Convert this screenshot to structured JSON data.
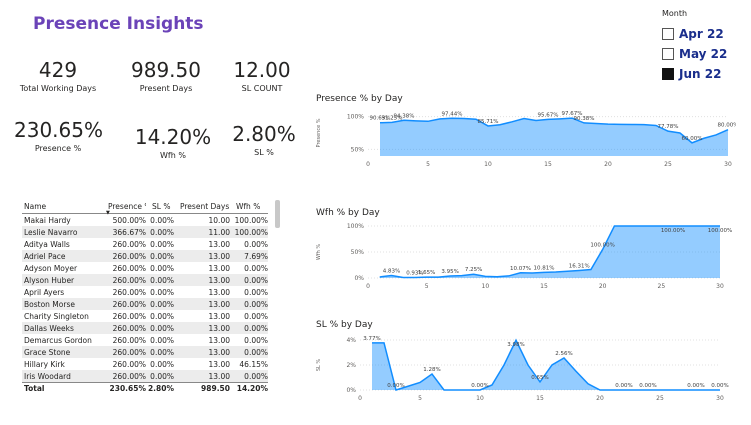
{
  "title": "Presence Insights",
  "kpis": [
    {
      "value": "429",
      "label": "Total Working Days"
    },
    {
      "value": "989.50",
      "label": "Present Days"
    },
    {
      "value": "12.00",
      "label": "SL COUNT"
    },
    {
      "value": "230.65%",
      "label": "Presence %"
    },
    {
      "value": "14.20%",
      "label": "Wfh %"
    },
    {
      "value": "2.80%",
      "label": "SL %"
    }
  ],
  "month_filter": {
    "title": "Month",
    "options": [
      {
        "label": "Apr 22",
        "checked": false
      },
      {
        "label": "May 22",
        "checked": false
      },
      {
        "label": "Jun 22",
        "checked": true
      }
    ]
  },
  "table": {
    "columns": [
      "Name",
      "Presence %",
      "SL %",
      "Present Days",
      "Wfh %"
    ],
    "rows": [
      [
        "Makai Hardy",
        "500.00%",
        "0.00%",
        "10.00",
        "100.00%"
      ],
      [
        "Leslie Navarro",
        "366.67%",
        "0.00%",
        "11.00",
        "100.00%"
      ],
      [
        "Aditya Walls",
        "260.00%",
        "0.00%",
        "13.00",
        "0.00%"
      ],
      [
        "Adriel Pace",
        "260.00%",
        "0.00%",
        "13.00",
        "7.69%"
      ],
      [
        "Adyson Moyer",
        "260.00%",
        "0.00%",
        "13.00",
        "0.00%"
      ],
      [
        "Alyson Huber",
        "260.00%",
        "0.00%",
        "13.00",
        "0.00%"
      ],
      [
        "April Ayers",
        "260.00%",
        "0.00%",
        "13.00",
        "0.00%"
      ],
      [
        "Boston Morse",
        "260.00%",
        "0.00%",
        "13.00",
        "0.00%"
      ],
      [
        "Charity Singleton",
        "260.00%",
        "0.00%",
        "13.00",
        "0.00%"
      ],
      [
        "Dallas Weeks",
        "260.00%",
        "0.00%",
        "13.00",
        "0.00%"
      ],
      [
        "Demarcus Gordon",
        "260.00%",
        "0.00%",
        "13.00",
        "0.00%"
      ],
      [
        "Grace Stone",
        "260.00%",
        "0.00%",
        "13.00",
        "0.00%"
      ],
      [
        "Hillary Kirk",
        "260.00%",
        "0.00%",
        "13.00",
        "46.15%"
      ],
      [
        "Iris Woodard",
        "260.00%",
        "0.00%",
        "13.00",
        "0.00%"
      ]
    ],
    "total": [
      "Total",
      "230.65%",
      "2.80%",
      "989.50",
      "14.20%"
    ]
  },
  "chart_data": [
    {
      "type": "area",
      "title": "Presence % by Day",
      "ylabel": "Presence %",
      "yticks": [
        "100%",
        "50%"
      ],
      "ylim": [
        40,
        110
      ],
      "xlim": [
        0,
        30
      ],
      "xticks": [
        0,
        5,
        10,
        15,
        20,
        25,
        30
      ],
      "x": [
        1,
        2,
        3,
        4,
        5,
        6,
        7,
        8,
        9,
        10,
        11,
        12,
        13,
        14,
        15,
        16,
        17,
        18,
        19,
        20,
        21,
        22,
        23,
        24,
        25,
        26,
        27,
        28,
        29,
        30
      ],
      "y": [
        90.63,
        91.25,
        94.38,
        93.5,
        92.8,
        96.5,
        97.44,
        97.0,
        96.0,
        85.71,
        87.5,
        92.0,
        97.0,
        94.0,
        95.67,
        96.5,
        97.67,
        90.38,
        89.5,
        88.5,
        88.2,
        88.0,
        87.8,
        86.5,
        77.78,
        75.0,
        60.0,
        67.0,
        72.0,
        80.0
      ],
      "labels": [
        {
          "x": 1,
          "text": "90.63%"
        },
        {
          "x": 2,
          "text": "91.25%"
        },
        {
          "x": 3,
          "text": "94.38%"
        },
        {
          "x": 7,
          "text": "97.44%"
        },
        {
          "x": 10,
          "text": "85.71%"
        },
        {
          "x": 15,
          "text": "95.67%"
        },
        {
          "x": 17,
          "text": "97.67%"
        },
        {
          "x": 18,
          "text": "90.38%"
        },
        {
          "x": 25,
          "text": "77.78%"
        },
        {
          "x": 27,
          "text": "60.00%"
        },
        {
          "x": 30,
          "text": "80.00%"
        }
      ],
      "color": "#118dff"
    },
    {
      "type": "area",
      "title": "Wfh % by Day",
      "ylabel": "Wfh %",
      "yticks": [
        "100%",
        "50%",
        "0%"
      ],
      "ylim": [
        0,
        100
      ],
      "xlim": [
        0,
        30
      ],
      "xticks": [
        0,
        5,
        10,
        15,
        20,
        25,
        30
      ],
      "x": [
        1,
        2,
        3,
        4,
        5,
        6,
        7,
        8,
        9,
        10,
        11,
        12,
        13,
        14,
        15,
        16,
        17,
        18,
        19,
        20,
        21,
        22,
        23,
        24,
        25,
        26,
        27,
        28,
        29,
        30
      ],
      "y": [
        2.0,
        4.83,
        1.0,
        0.93,
        1.65,
        1.8,
        3.95,
        4.5,
        7.25,
        3.2,
        2.5,
        4.0,
        10.07,
        9.5,
        10.81,
        11.5,
        13.0,
        14.5,
        16.31,
        55.0,
        100.0,
        100.0,
        100.0,
        100.0,
        100.0,
        100.0,
        100.0,
        100.0,
        100.0,
        100.0
      ],
      "labels": [
        {
          "x": 2,
          "text": "4.83%"
        },
        {
          "x": 4,
          "text": "0.93%"
        },
        {
          "x": 5,
          "text": "1.65%"
        },
        {
          "x": 7,
          "text": "3.95%"
        },
        {
          "x": 9,
          "text": "7.25%"
        },
        {
          "x": 13,
          "text": "10.07%"
        },
        {
          "x": 15,
          "text": "10.81%"
        },
        {
          "x": 18,
          "text": "16.31%"
        },
        {
          "x": 20,
          "text": "100.00%"
        },
        {
          "x": 26,
          "text": "100.00%"
        },
        {
          "x": 30,
          "text": "100.00%"
        }
      ],
      "color": "#118dff"
    },
    {
      "type": "area",
      "title": "SL % by Day",
      "ylabel": "SL %",
      "yticks": [
        "4%",
        "2%",
        "0%"
      ],
      "ylim": [
        0,
        4
      ],
      "xlim": [
        0,
        30
      ],
      "xticks": [
        0,
        5,
        10,
        15,
        20,
        25,
        30
      ],
      "x": [
        1,
        2,
        3,
        4,
        5,
        6,
        7,
        8,
        9,
        10,
        11,
        12,
        13,
        14,
        15,
        16,
        17,
        18,
        19,
        20,
        21,
        22,
        23,
        24,
        25,
        26,
        27,
        28,
        29,
        30
      ],
      "y": [
        3.77,
        3.77,
        0.0,
        0.3,
        0.6,
        1.28,
        0.0,
        0.0,
        0.0,
        0.0,
        0.4,
        2.0,
        3.98,
        2.0,
        0.65,
        2.0,
        2.56,
        1.5,
        0.5,
        0.0,
        0.0,
        0.0,
        0.0,
        0.0,
        0.0,
        0.0,
        0.0,
        0.0,
        0.0,
        0.0
      ],
      "labels": [
        {
          "x": 1,
          "text": "3.77%"
        },
        {
          "x": 3,
          "text": "0.00%"
        },
        {
          "x": 6,
          "text": "1.28%"
        },
        {
          "x": 10,
          "text": "0.00%"
        },
        {
          "x": 13,
          "text": "3.98%"
        },
        {
          "x": 15,
          "text": "0.65%"
        },
        {
          "x": 17,
          "text": "2.56%"
        },
        {
          "x": 22,
          "text": "0.00%"
        },
        {
          "x": 24,
          "text": "0.00%"
        },
        {
          "x": 28,
          "text": "0.00%"
        },
        {
          "x": 30,
          "text": "0.00%"
        }
      ],
      "color": "#118dff"
    }
  ]
}
